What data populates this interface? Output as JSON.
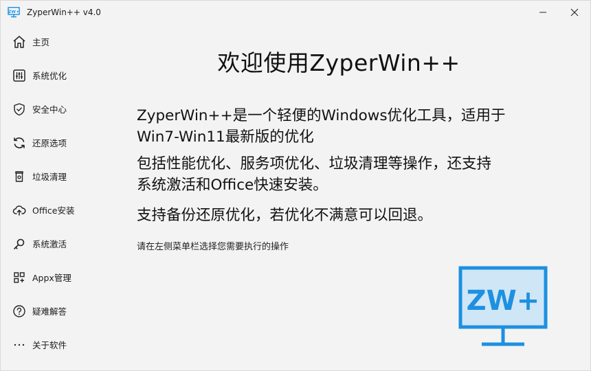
{
  "window": {
    "title": "ZyperWin++ v4.0",
    "app_icon_text": "ZW+",
    "accent_color": "#1e90e0"
  },
  "sidebar": {
    "items": [
      {
        "label": "主页",
        "icon": "home-icon"
      },
      {
        "label": "系统优化",
        "icon": "sliders-icon"
      },
      {
        "label": "安全中心",
        "icon": "shield-icon"
      },
      {
        "label": "还原选项",
        "icon": "refresh-icon"
      },
      {
        "label": "垃圾清理",
        "icon": "trash-icon"
      },
      {
        "label": "Office安装",
        "icon": "cloud-upload-icon"
      },
      {
        "label": "系统激活",
        "icon": "key-icon"
      },
      {
        "label": "Appx管理",
        "icon": "apps-icon"
      },
      {
        "label": "疑难解答",
        "icon": "help-icon"
      },
      {
        "label": "关于软件",
        "icon": "more-icon"
      }
    ]
  },
  "main": {
    "title": "欢迎使用ZyperWin++",
    "desc_lines": [
      "ZyperWin++是一个轻便的Windows优化工具，适用于",
      "Win7-Win11最新版的优化",
      "包括性能优化、服务项优化、垃圾清理等操作，还支持",
      "系统激活和Office快速安装。",
      "支持备份还原优化，若优化不满意可以回退。"
    ],
    "hint": "请在左侧菜单栏选择您需要执行的操作",
    "logo_text": "ZW+"
  }
}
